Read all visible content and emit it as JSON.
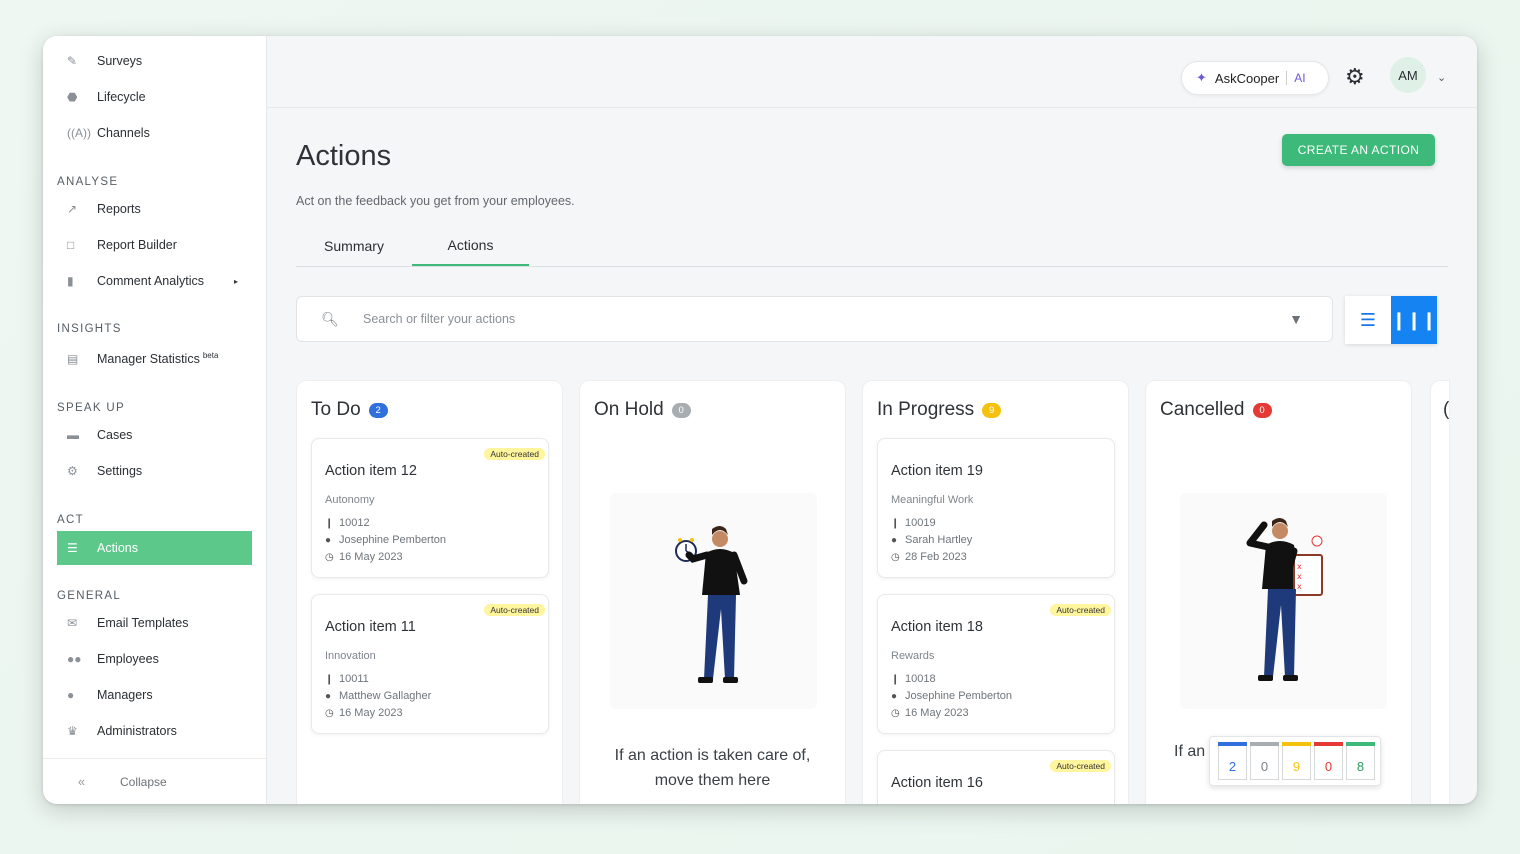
{
  "sidebar": {
    "items_top": [
      {
        "label": "Surveys",
        "icon": "brush-icon"
      },
      {
        "label": "Lifecycle",
        "icon": "lifecycle-icon"
      },
      {
        "label": "Channels",
        "icon": "broadcast-icon"
      }
    ],
    "analyse": {
      "label": "ANALYSE",
      "items": [
        {
          "label": "Reports",
          "icon": "line-chart-icon"
        },
        {
          "label": "Report Builder",
          "icon": "file-edit-icon"
        },
        {
          "label": "Comment Analytics",
          "icon": "bar-chart-icon"
        }
      ]
    },
    "insights": {
      "label": "INSIGHTS",
      "items": [
        {
          "label": "Manager Statistics",
          "sup": "beta",
          "icon": "presentation-icon"
        }
      ]
    },
    "speak_up": {
      "label": "SPEAK UP",
      "items": [
        {
          "label": "Cases",
          "icon": "folder-icon"
        },
        {
          "label": "Settings",
          "icon": "gear-icon"
        }
      ]
    },
    "act": {
      "label": "ACT",
      "items": [
        {
          "label": "Actions",
          "icon": "list-icon",
          "active": true
        }
      ]
    },
    "general": {
      "label": "GENERAL",
      "items": [
        {
          "label": "Email Templates",
          "icon": "email-template-icon"
        },
        {
          "label": "Employees",
          "icon": "users-icon"
        },
        {
          "label": "Managers",
          "icon": "user-icon"
        },
        {
          "label": "Administrators",
          "icon": "crown-icon"
        }
      ]
    },
    "collapse_label": "Collapse"
  },
  "topbar": {
    "askcooper": "AskCooper",
    "ai": "AI",
    "avatar_initials": "AM"
  },
  "page": {
    "title": "Actions",
    "subtitle": "Act on the feedback you get from your employees.",
    "create_button": "CREATE AN ACTION",
    "tabs": [
      "Summary",
      "Actions"
    ],
    "active_tab": "Actions",
    "search_placeholder": "Search or filter your actions"
  },
  "columns": {
    "todo": {
      "title": "To Do",
      "count": "2",
      "badge_color": "#2f6fde",
      "cards": [
        {
          "auto": "Auto-created",
          "title": "Action item 12",
          "category": "Autonomy",
          "id": "10012",
          "person": "Josephine Pemberton",
          "date": "16 May 2023"
        },
        {
          "auto": "Auto-created",
          "title": "Action item 11",
          "category": "Innovation",
          "id": "10011",
          "person": "Matthew Gallagher",
          "date": "16 May 2023"
        }
      ]
    },
    "onhold": {
      "title": "On Hold",
      "count": "0",
      "badge_color": "#a8adb2",
      "empty_line1": "If an action is taken care of,",
      "empty_line2": "move them here"
    },
    "inprogress": {
      "title": "In Progress",
      "count": "9",
      "badge_color": "#f4c20d",
      "cards": [
        {
          "auto": "",
          "title": "Action item 19",
          "category": "Meaningful Work",
          "id": "10019",
          "person": "Sarah Hartley",
          "date": "28 Feb 2023"
        },
        {
          "auto": "Auto-created",
          "title": "Action item 18",
          "category": "Rewards",
          "id": "10018",
          "person": "Josephine Pemberton",
          "date": "16 May 2023"
        },
        {
          "auto": "Auto-created",
          "title": "Action item 16"
        }
      ]
    },
    "cancelled": {
      "title": "Cancelled",
      "count": "0",
      "badge_color": "#e53935",
      "empty_partial": "If an"
    },
    "next_partial": "("
  },
  "mini_board": {
    "values": [
      "2",
      "0",
      "9",
      "0",
      "8"
    ],
    "colors": [
      "#2f6fde",
      "#a8adb2",
      "#f4c20d",
      "#e53935",
      "#3dba79"
    ]
  }
}
